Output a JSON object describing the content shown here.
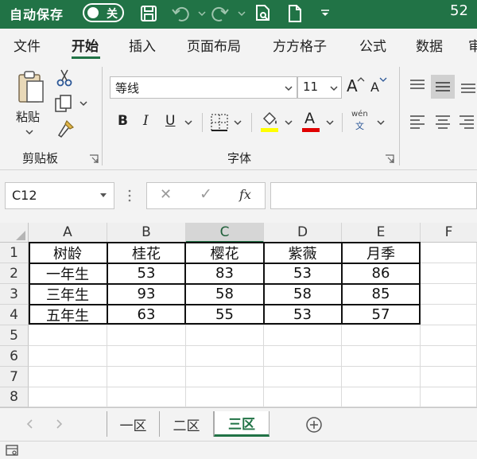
{
  "titlebar": {
    "autosave_label": "自动保存",
    "autosave_state": "关",
    "right_text": "52"
  },
  "ribbon_tabs": [
    {
      "label": "文件",
      "active": false
    },
    {
      "label": "开始",
      "active": true
    },
    {
      "label": "插入",
      "active": false
    },
    {
      "label": "页面布局",
      "active": false
    },
    {
      "label": "方方格子",
      "active": false
    },
    {
      "label": "公式",
      "active": false
    },
    {
      "label": "数据",
      "active": false
    },
    {
      "label": "审",
      "active": false
    }
  ],
  "clipboard": {
    "paste_label": "粘贴",
    "group_label": "剪贴板"
  },
  "font": {
    "name": "等线",
    "size": "11",
    "group_label": "字体",
    "bold": "B",
    "italic": "I",
    "underline": "U",
    "phonetic_top": "wén",
    "phonetic_bottom": "文",
    "font_color_glyph": "A",
    "grow_glyph": "A",
    "shrink_glyph": "A",
    "highlight_color": "#ffff00",
    "font_color": "#e00000"
  },
  "formula_bar": {
    "name_box": "C12",
    "cancel": "✕",
    "enter": "✓",
    "fx": "fx",
    "formula": ""
  },
  "sheet": {
    "columns": [
      "A",
      "B",
      "C",
      "D",
      "E",
      "F"
    ],
    "rows": [
      "1",
      "2",
      "3",
      "4",
      "5",
      "6",
      "7",
      "8"
    ],
    "selected_column": "C",
    "table": [
      [
        "树龄",
        "桂花",
        "樱花",
        "紫薇",
        "月季"
      ],
      [
        "一年生",
        "53",
        "83",
        "53",
        "86"
      ],
      [
        "三年生",
        "93",
        "58",
        "58",
        "85"
      ],
      [
        "五年生",
        "63",
        "55",
        "53",
        "57"
      ]
    ]
  },
  "sheet_tabs": [
    {
      "label": "一区",
      "active": false
    },
    {
      "label": "二区",
      "active": false
    },
    {
      "label": "三区",
      "active": true
    }
  ],
  "colors": {
    "accent": "#217346"
  }
}
